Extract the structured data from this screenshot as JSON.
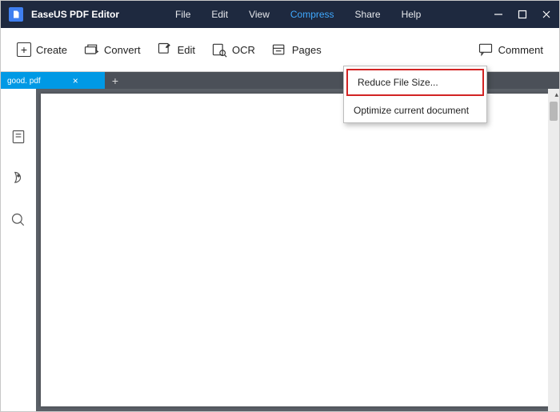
{
  "app": {
    "title": "EaseUS PDF Editor"
  },
  "menu": {
    "file": "File",
    "edit": "Edit",
    "view": "View",
    "compress": "Compress",
    "share": "Share",
    "help": "Help"
  },
  "toolbar": {
    "create": "Create",
    "convert": "Convert",
    "edit": "Edit",
    "ocr": "OCR",
    "pages": "Pages",
    "comment": "Comment"
  },
  "dropdown": {
    "reduce": "Reduce File Size...",
    "optimize": "Optimize current document"
  },
  "tab": {
    "filename": "good. pdf"
  }
}
